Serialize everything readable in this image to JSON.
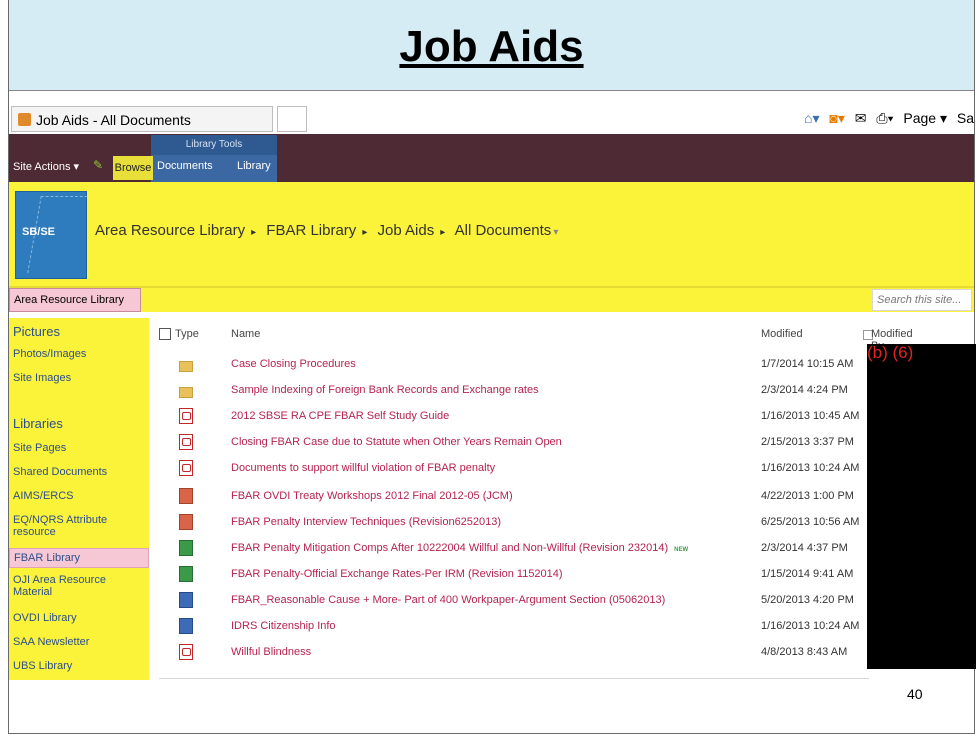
{
  "slide": {
    "title": "Job Aids",
    "page_number": "40"
  },
  "browser": {
    "tab_title": "Job Aids - All Documents",
    "commands": {
      "page": "Page ▾",
      "safety": "Sa"
    }
  },
  "ribbon": {
    "site_actions": "Site Actions ▾",
    "browse": "Browse",
    "library_tools": "Library Tools",
    "documents": "Documents",
    "library": "Library"
  },
  "banner": {
    "logo_text": "SB/SE",
    "breadcrumb": [
      "Area Resource Library",
      "FBAR Library",
      "Job Aids",
      "All Documents"
    ]
  },
  "nav": {
    "top_tab": "Area Resource Library",
    "search_placeholder": "Search this site..."
  },
  "sidebar": {
    "pictures_heading": "Pictures",
    "pictures": [
      "Photos/Images",
      "Site Images"
    ],
    "libraries_heading": "Libraries",
    "libraries": [
      "Site Pages",
      "Shared Documents",
      "AIMS/ERCS",
      "EQ/NQRS Attribute resource",
      "FBAR Library",
      "OJI Area Resource Material",
      "OVDI Library",
      "SAA Newsletter",
      "UBS Library"
    ]
  },
  "list": {
    "headers": {
      "type": "Type",
      "name": "Name",
      "modified": "Modified",
      "modified_by": "Modified By"
    },
    "rows": [
      {
        "icon": "folder-icon",
        "name": "Case Closing Procedures",
        "modified": "1/7/2014 10:15 AM"
      },
      {
        "icon": "folder-icon",
        "name": "Sample Indexing of Foreign Bank Records and Exchange rates",
        "modified": "2/3/2014 4:24 PM"
      },
      {
        "icon": "pdf-icon",
        "name": "2012 SBSE RA CPE FBAR Self Study Guide",
        "modified": "1/16/2013 10:45 AM"
      },
      {
        "icon": "pdf-icon",
        "name": "Closing FBAR Case due to Statute when Other Years Remain Open",
        "modified": "2/15/2013 3:37 PM"
      },
      {
        "icon": "pdf-icon",
        "name": "Documents to support willful violation of FBAR penalty",
        "modified": "1/16/2013 10:24 AM"
      },
      {
        "icon": "ppt-icon",
        "name": "FBAR OVDI Treaty Workshops 2012 Final 2012-05 (JCM)",
        "modified": "4/22/2013 1:00 PM"
      },
      {
        "icon": "ppt-icon",
        "name": "FBAR Penalty Interview Techniques (Revision6252013)",
        "modified": "6/25/2013 10:56 AM"
      },
      {
        "icon": "xls-icon",
        "name": "FBAR Penalty Mitigation Comps After 10222004 Willful and Non-Willful (Revision 232014)",
        "modified": "2/3/2014 4:37 PM",
        "badge": "NEW"
      },
      {
        "icon": "xls-icon",
        "name": "FBAR Penalty-Official Exchange Rates-Per IRM (Revision 1152014)",
        "modified": "1/15/2014 9:41 AM"
      },
      {
        "icon": "doc-icon",
        "name": "FBAR_Reasonable Cause + More- Part of 400 Workpaper-Argument Section (05062013)",
        "modified": "5/20/2013 4:20 PM"
      },
      {
        "icon": "doc-icon",
        "name": "IDRS Citizenship Info",
        "modified": "1/16/2013 10:24 AM"
      },
      {
        "icon": "pdf-icon",
        "name": "Willful Blindness",
        "modified": "4/8/2013 8:43 AM"
      }
    ]
  },
  "redaction_label": "(b) (6)"
}
